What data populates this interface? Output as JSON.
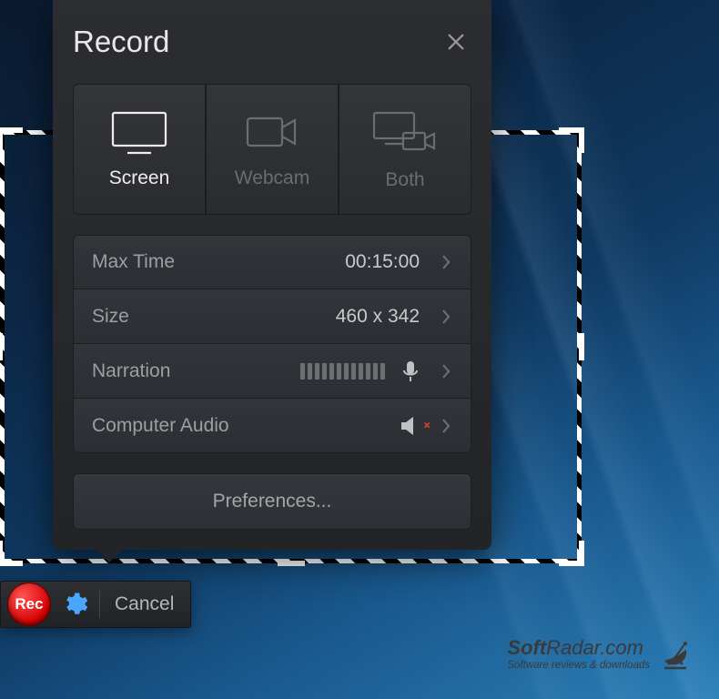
{
  "panel": {
    "title": "Record",
    "modes": {
      "screen": "Screen",
      "webcam": "Webcam",
      "both": "Both"
    },
    "max_time": {
      "label": "Max Time",
      "value": "00:15:00"
    },
    "size": {
      "label": "Size",
      "value": "460 x 342"
    },
    "narration": {
      "label": "Narration"
    },
    "computer_audio": {
      "label": "Computer Audio"
    },
    "preferences_label": "Preferences..."
  },
  "toolbar": {
    "rec_label": "Rec",
    "cancel_label": "Cancel"
  },
  "watermark": {
    "site_prefix": "Soft",
    "site_suffix": "Radar.com",
    "tagline": "Software reviews & downloads"
  }
}
